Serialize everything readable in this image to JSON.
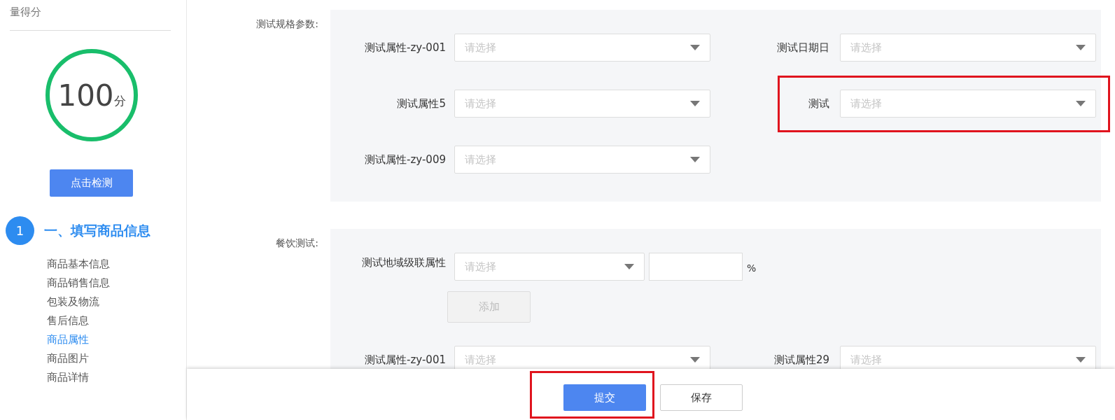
{
  "sidebar": {
    "intro_tail": "量得分",
    "score": {
      "value": "100",
      "unit": "分"
    },
    "check_button": "点击检测",
    "step": {
      "number": "1",
      "title": "一、填写商品信息"
    },
    "nav": [
      {
        "label": "商品基本信息",
        "selected": false
      },
      {
        "label": "商品销售信息",
        "selected": false
      },
      {
        "label": "包装及物流",
        "selected": false
      },
      {
        "label": "售后信息",
        "selected": false
      },
      {
        "label": "商品属性",
        "selected": true
      },
      {
        "label": "商品图片",
        "selected": false
      },
      {
        "label": "商品详情",
        "selected": false
      }
    ]
  },
  "sections": [
    {
      "label": "测试规格参数:",
      "rows": [
        [
          {
            "kind": "select",
            "label": "测试属性-zy-001",
            "placeholder": "请选择",
            "highlighted": false
          },
          {
            "kind": "select",
            "label": "测试日期日",
            "placeholder": "请选择",
            "highlighted": false
          }
        ],
        [
          {
            "kind": "select",
            "label": "测试属性5",
            "placeholder": "请选择",
            "highlighted": false
          },
          {
            "kind": "select",
            "label": "测试",
            "placeholder": "请选择",
            "highlighted": true
          }
        ],
        [
          {
            "kind": "select",
            "label": "测试属性-zy-009",
            "placeholder": "请选择",
            "highlighted": false
          }
        ]
      ]
    },
    {
      "label": "餐饮测试:",
      "rows": [
        [
          {
            "kind": "cascade",
            "label": "测试地域级联属性",
            "placeholder": "请选择",
            "unit": "%",
            "add_button": {
              "label": "添加",
              "disabled": true
            }
          }
        ],
        [
          {
            "kind": "select",
            "label": "测试属性-zy-001",
            "placeholder": "请选择",
            "highlighted": false
          },
          {
            "kind": "select",
            "label": "测试属性29",
            "placeholder": "请选择",
            "highlighted": false
          }
        ]
      ]
    }
  ],
  "footer": {
    "buttons": [
      {
        "label": "提交",
        "kind": "primary",
        "highlighted": true
      },
      {
        "label": "保存",
        "kind": "default",
        "highlighted": false
      }
    ]
  }
}
